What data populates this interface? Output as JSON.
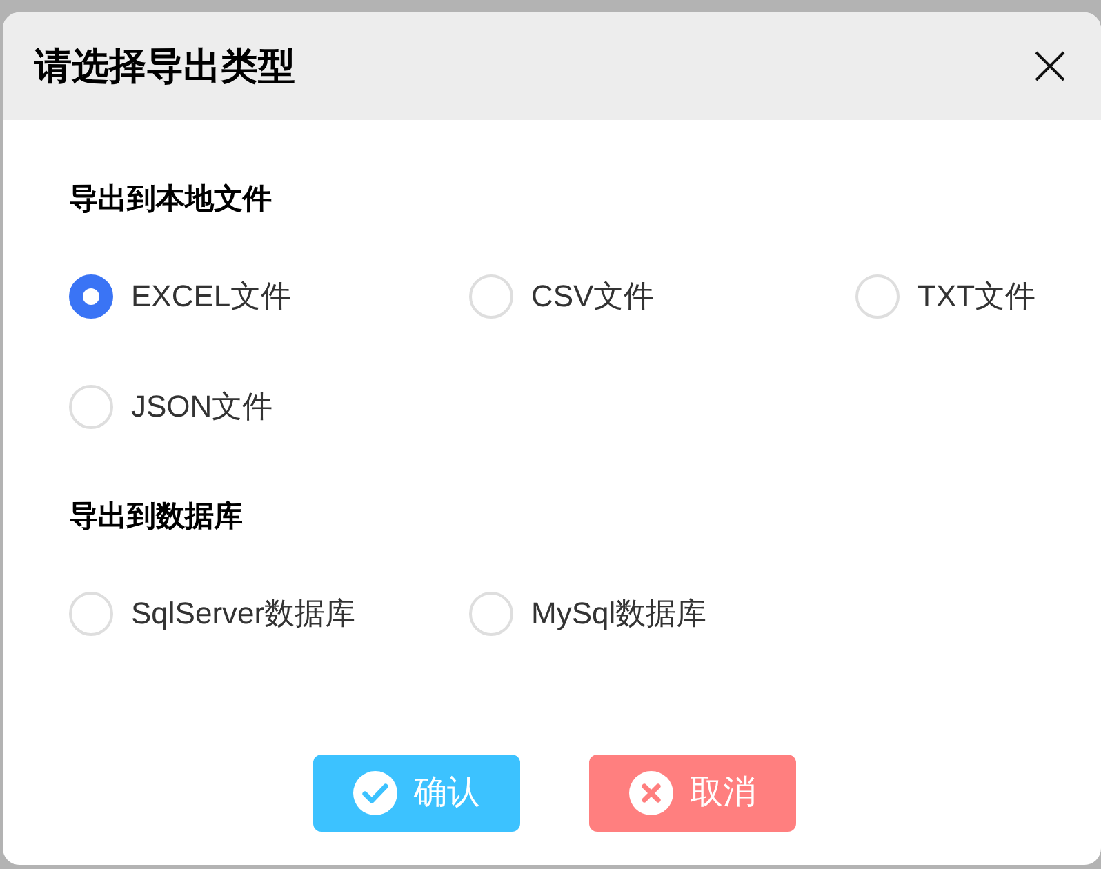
{
  "dialog": {
    "title": "请选择导出类型",
    "sections": [
      {
        "heading": "导出到本地文件",
        "options": [
          {
            "label": "EXCEL文件",
            "selected": true
          },
          {
            "label": "CSV文件",
            "selected": false
          },
          {
            "label": "TXT文件",
            "selected": false
          },
          {
            "label": "JSON文件",
            "selected": false
          }
        ]
      },
      {
        "heading": "导出到数据库",
        "options": [
          {
            "label": "SqlServer数据库",
            "selected": false
          },
          {
            "label": "MySql数据库",
            "selected": false
          }
        ]
      }
    ],
    "buttons": [
      {
        "label": "确认",
        "kind": "confirm"
      },
      {
        "label": "取消",
        "kind": "cancel"
      }
    ]
  }
}
